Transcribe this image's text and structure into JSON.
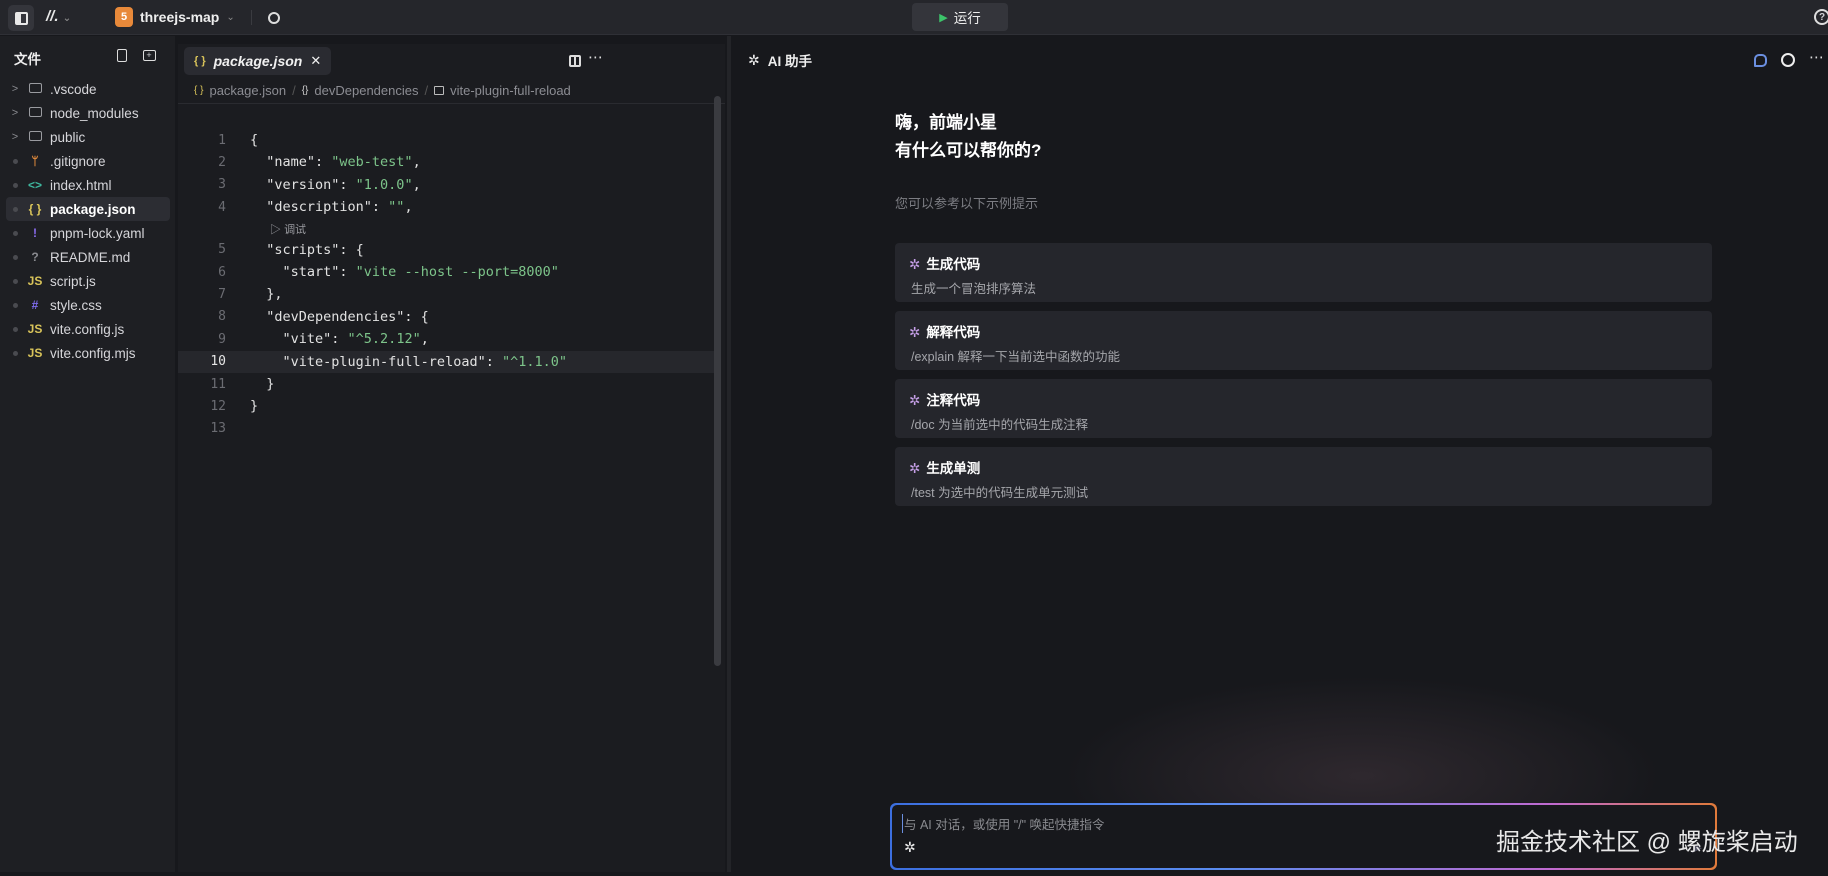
{
  "topbar": {
    "project": "threejs-map",
    "run_label": "运行"
  },
  "sidebar": {
    "title": "文件",
    "files": [
      {
        "name": ".vscode",
        "type": "folder",
        "icon": "folder-icon"
      },
      {
        "name": "node_modules",
        "type": "folder",
        "icon": "folder-icon"
      },
      {
        "name": "public",
        "type": "folder",
        "icon": "folder-icon"
      },
      {
        "name": ".gitignore",
        "type": "file",
        "icon": "git-icon",
        "glyph": "ᛘ",
        "color": "#e08a3c"
      },
      {
        "name": "index.html",
        "type": "file",
        "icon": "html-icon",
        "glyph": "<>",
        "color": "#3fb9a0"
      },
      {
        "name": "package.json",
        "type": "file",
        "icon": "json-icon",
        "glyph": "{ }",
        "color": "#d9c45a",
        "active": true
      },
      {
        "name": "pnpm-lock.yaml",
        "type": "file",
        "icon": "yaml-icon",
        "glyph": "!",
        "color": "#8b6cf0"
      },
      {
        "name": "README.md",
        "type": "file",
        "icon": "info-icon",
        "glyph": "?",
        "color": "#8a8b90"
      },
      {
        "name": "script.js",
        "type": "file",
        "icon": "js-icon",
        "glyph": "JS",
        "color": "#d9c45a"
      },
      {
        "name": "style.css",
        "type": "file",
        "icon": "css-icon",
        "glyph": "#",
        "color": "#7f6cf0"
      },
      {
        "name": "vite.config.js",
        "type": "file",
        "icon": "js-icon",
        "glyph": "JS",
        "color": "#d9c45a"
      },
      {
        "name": "vite.config.mjs",
        "type": "file",
        "icon": "js-icon",
        "glyph": "JS",
        "color": "#d9c45a"
      }
    ]
  },
  "editor": {
    "tab": "package.json",
    "breadcrumb": [
      "package.json",
      "devDependencies",
      "vite-plugin-full-reload"
    ],
    "codelens": "调试",
    "lines": [
      {
        "n": "1",
        "k": "{",
        "s": "",
        "e": ""
      },
      {
        "n": "2",
        "k": "  \"name\": ",
        "s": "\"web-test\"",
        "e": ","
      },
      {
        "n": "3",
        "k": "  \"version\": ",
        "s": "\"1.0.0\"",
        "e": ","
      },
      {
        "n": "4",
        "k": "  \"description\": ",
        "s": "\"\"",
        "e": ","
      },
      {
        "n": "5",
        "k": "  \"scripts\": {",
        "s": "",
        "e": ""
      },
      {
        "n": "6",
        "k": "    \"start\": ",
        "s": "\"vite --host --port=8000\"",
        "e": ""
      },
      {
        "n": "7",
        "k": "  },",
        "s": "",
        "e": ""
      },
      {
        "n": "8",
        "k": "  \"devDependencies\": {",
        "s": "",
        "e": ""
      },
      {
        "n": "9",
        "k": "    \"vite\": ",
        "s": "\"^5.2.12\"",
        "e": ","
      },
      {
        "n": "10",
        "k": "    \"vite-plugin-full-reload\": ",
        "s": "\"^1.1.0\"",
        "e": ""
      },
      {
        "n": "11",
        "k": "  }",
        "s": "",
        "e": ""
      },
      {
        "n": "12",
        "k": "}",
        "s": "",
        "e": ""
      },
      {
        "n": "13",
        "k": "",
        "s": "",
        "e": ""
      }
    ]
  },
  "ai": {
    "title": "AI 助手",
    "greeting1": "嗨，前端小星",
    "greeting2": "有什么可以帮你的?",
    "hint": "您可以参考以下示例提示",
    "cards": [
      {
        "title": "生成代码",
        "desc": "生成一个冒泡排序算法"
      },
      {
        "title": "解释代码",
        "desc": "/explain 解释一下当前选中函数的功能"
      },
      {
        "title": "注释代码",
        "desc": "/doc 为当前选中的代码生成注释"
      },
      {
        "title": "生成单测",
        "desc": "/test 为选中的代码生成单元测试"
      }
    ],
    "input_placeholder": "与 AI 对话，或使用 \"/\" 唤起快捷指令"
  },
  "watermark": "掘金技术社区 @ 螺旋桨启动"
}
